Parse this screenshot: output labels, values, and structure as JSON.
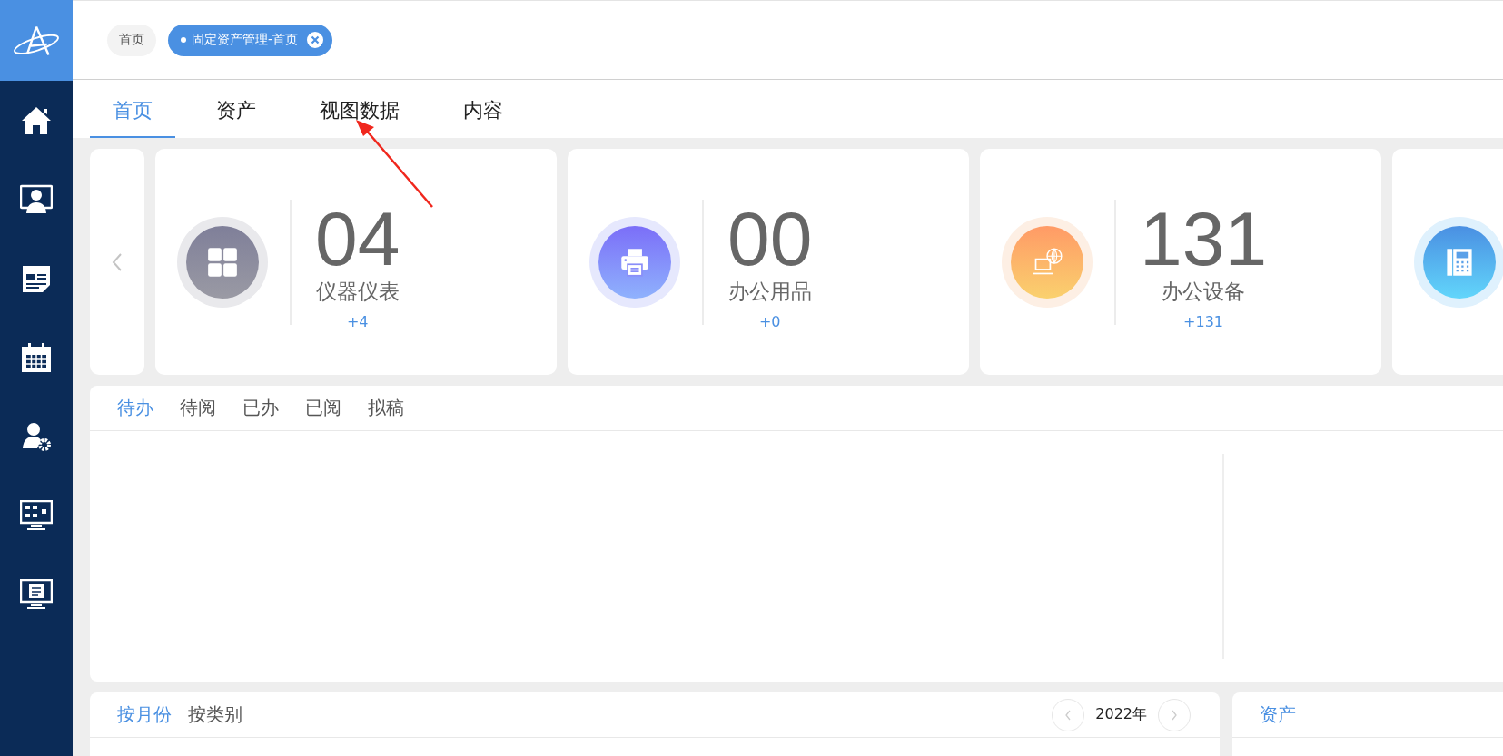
{
  "sidebar": {
    "items": [
      {
        "kind": "home"
      },
      {
        "kind": "monitor-user"
      },
      {
        "kind": "newspaper"
      },
      {
        "kind": "calendar"
      },
      {
        "kind": "user-gear"
      },
      {
        "kind": "monitor-flow"
      },
      {
        "kind": "monitor-doc"
      }
    ]
  },
  "breadcrumbs": [
    {
      "label": "首页",
      "selected": false,
      "closable": false
    },
    {
      "label": "固定资产管理-首页",
      "selected": true,
      "closable": true
    }
  ],
  "tabs": [
    {
      "label": "首页",
      "selected": true
    },
    {
      "label": "资产",
      "selected": false
    },
    {
      "label": "视图数据",
      "selected": false
    },
    {
      "label": "内容",
      "selected": false
    }
  ],
  "stat_cards": [
    {
      "kind": "grid",
      "value": "04",
      "label": "仪器仪表",
      "delta": "+4"
    },
    {
      "kind": "printer",
      "value": "00",
      "label": "办公用品",
      "delta": "+0"
    },
    {
      "kind": "computer",
      "value": "131",
      "label": "办公设备",
      "delta": "+131"
    },
    {
      "kind": "phone"
    }
  ],
  "task_tabs": [
    {
      "label": "待办",
      "selected": true
    },
    {
      "label": "待阅",
      "selected": false
    },
    {
      "label": "已办",
      "selected": false
    },
    {
      "label": "已阅",
      "selected": false
    },
    {
      "label": "拟稿",
      "selected": false
    }
  ],
  "stats_panel": {
    "tabs": [
      {
        "label": "按月份",
        "selected": true
      },
      {
        "label": "按类别",
        "selected": false
      }
    ],
    "year": "2022年"
  },
  "asset_panel": {
    "title": "资产"
  }
}
